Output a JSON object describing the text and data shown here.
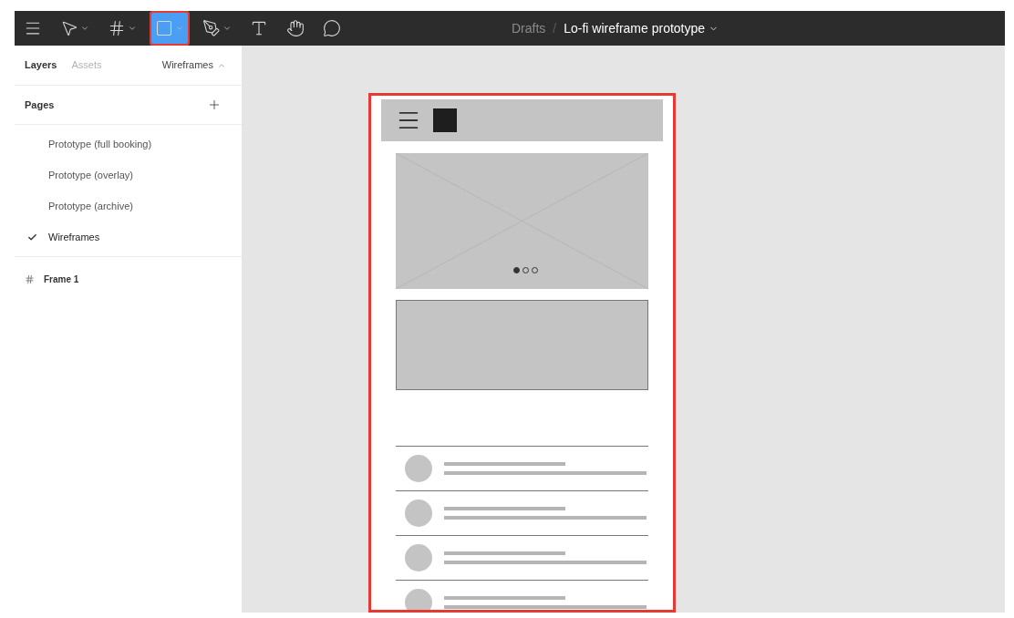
{
  "toolbar": {
    "tools": [
      {
        "kind": "menu",
        "selected": false,
        "has_caret": false
      },
      {
        "kind": "move",
        "selected": false,
        "has_caret": true
      },
      {
        "kind": "frame",
        "selected": false,
        "has_caret": true
      },
      {
        "kind": "rectangle",
        "selected": true,
        "has_caret": true
      },
      {
        "kind": "pen",
        "selected": false,
        "has_caret": true
      },
      {
        "kind": "text",
        "selected": false,
        "has_caret": false
      },
      {
        "kind": "hand",
        "selected": false,
        "has_caret": false
      },
      {
        "kind": "comment",
        "selected": false,
        "has_caret": false
      }
    ],
    "breadcrumb": {
      "parent": "Drafts",
      "separator": "/",
      "file": "Lo-fi wireframe prototype"
    }
  },
  "sidebar": {
    "tabs": [
      {
        "label": "Layers",
        "selected": true
      },
      {
        "label": "Assets",
        "selected": false
      }
    ],
    "page_switcher": "Wireframes",
    "pages_header": "Pages",
    "pages": [
      {
        "label": "Prototype (full booking)",
        "selected": false
      },
      {
        "label": "Prototype (overlay)",
        "selected": false
      },
      {
        "label": "Prototype (archive)",
        "selected": false
      },
      {
        "label": "Wireframes",
        "selected": true
      }
    ],
    "layers": [
      {
        "label": "Frame 1"
      }
    ]
  },
  "canvas": {
    "frame": {
      "highlighted": true,
      "carousel_dots": [
        {
          "selected": true
        },
        {
          "selected": false
        },
        {
          "selected": false
        }
      ]
    }
  }
}
